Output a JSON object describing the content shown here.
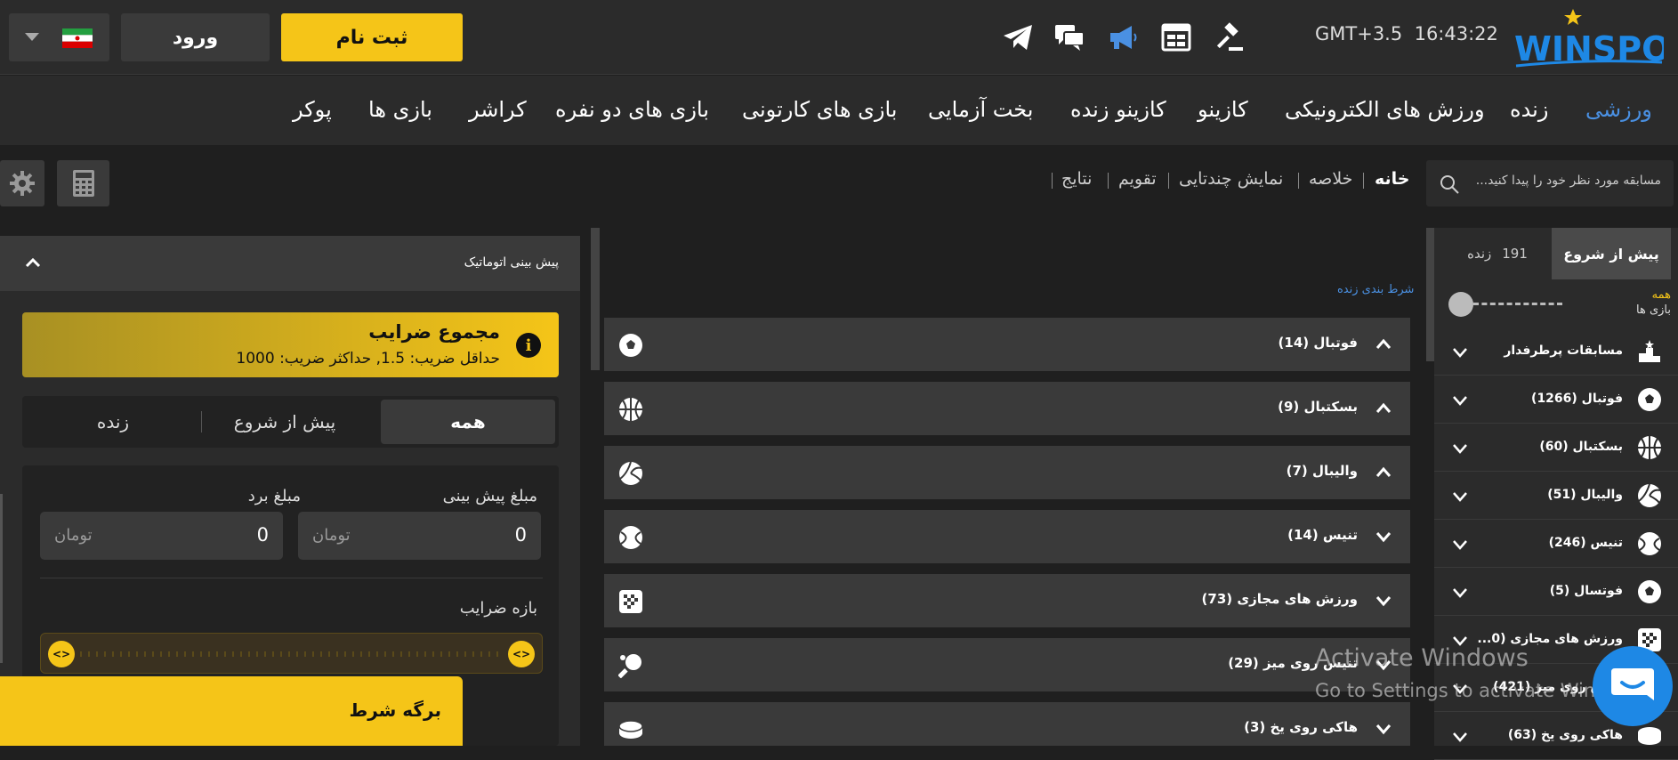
{
  "header": {
    "register_label": "ثبت نام",
    "login_label": "ورود",
    "time": "16:43:22",
    "timezone": "GMT+3.5",
    "logo_text": "WINSPORT",
    "icons": [
      "telegram-icon",
      "chat-icon",
      "megaphone-icon",
      "calendar-icon",
      "gavel-icon"
    ]
  },
  "main_nav": [
    "ورزشی",
    "زنده",
    "ورزش های الکترونیکی",
    "کازینو",
    "کازینو زنده",
    "بخت آزمایی",
    "بازی های کارتونی",
    "بازی های دو نفره",
    "کراشر",
    "بازی ها",
    "پوکر"
  ],
  "subbar": {
    "search_placeholder": "مسابقه مورد نظر خود را پیدا کنید...",
    "tabs": [
      "خانه",
      "خلاصه",
      "نمایش چندتایی",
      "تقویم",
      "نتایج"
    ]
  },
  "auto_bet": {
    "title": "پیش بینی اتوماتیک",
    "odds_title": "مجموع ضرایب",
    "odds_sub": "حداقل ضریب: 1.5, حداکثر ضریب: 1000",
    "filters": [
      "همه",
      "پیش از شروع",
      "زنده"
    ],
    "stake_label": "مبلغ پیش بینی",
    "win_label": "مبلغ برد",
    "stake_value": "0",
    "win_value": "0",
    "currency": "تومان",
    "range_label": "بازه ضرایب",
    "betslip_label": "برگه شرط"
  },
  "center": {
    "live_link": "شرط بندی زنده",
    "sports": [
      {
        "name": "فوتبال",
        "count": "(14)",
        "icon": "football-icon",
        "open": true
      },
      {
        "name": "بسکتبال",
        "count": "(9)",
        "icon": "basketball-icon",
        "open": true
      },
      {
        "name": "والیبال",
        "count": "(7)",
        "icon": "volleyball-icon",
        "open": true
      },
      {
        "name": "تنیس",
        "count": "(14)",
        "icon": "tennis-icon",
        "open": false
      },
      {
        "name": "ورزش های مجازی",
        "count": "(73)",
        "icon": "virtual-sports-icon",
        "open": false
      },
      {
        "name": "تنیس روی میز",
        "count": "(29)",
        "icon": "table-tennis-icon",
        "open": false
      },
      {
        "name": "هاکی روی یخ",
        "count": "(3)",
        "icon": "ice-hockey-icon",
        "open": false
      }
    ]
  },
  "sidebar": {
    "tab_prematch": "پیش از شروع",
    "tab_live": "زنده",
    "live_count": "191",
    "all_label": "همه",
    "games_label": "بازی ها",
    "items": [
      {
        "name": "مسابقات پرطرفدار",
        "icon": "podium-icon"
      },
      {
        "name": "فوتبال (1266)",
        "icon": "football-icon"
      },
      {
        "name": "بسکتبال (60)",
        "icon": "basketball-icon"
      },
      {
        "name": "والیبال (51)",
        "icon": "volleyball-icon"
      },
      {
        "name": "تنیس (246)",
        "icon": "tennis-icon"
      },
      {
        "name": "فوتسال (5)",
        "icon": "futsal-icon"
      },
      {
        "name": "ورزش های مجازی (0...",
        "icon": "virtual-sports-icon"
      },
      {
        "name": "تنیس روی میز (421)",
        "icon": "table-tennis-icon"
      },
      {
        "name": "هاکی روی یخ (63)",
        "icon": "ice-hockey-icon"
      }
    ]
  },
  "watermark": {
    "line1": "Activate Windows",
    "line2": "Go to Settings to activate Windows."
  },
  "colors": {
    "accent": "#f5c518",
    "active_nav": "#4a90e2",
    "panel": "#2b2b2b"
  }
}
